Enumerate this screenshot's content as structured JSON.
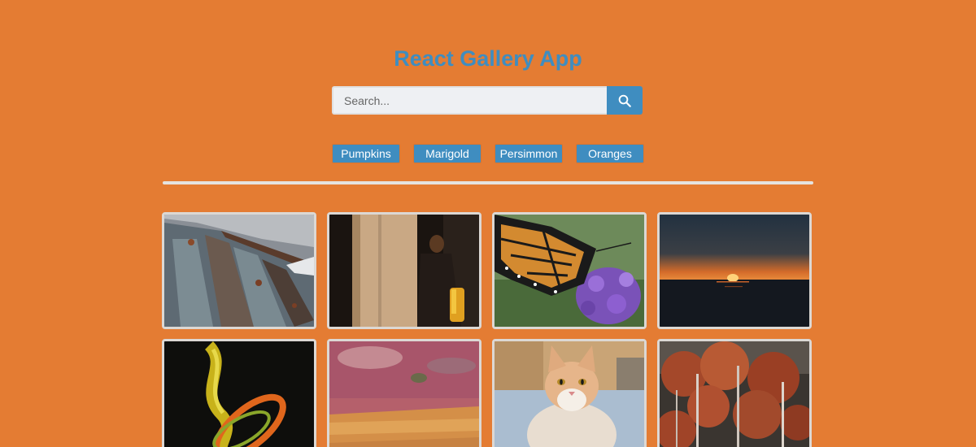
{
  "header": {
    "title": "React Gallery App"
  },
  "search": {
    "placeholder": "Search...",
    "value": "",
    "button_icon": "search-icon"
  },
  "nav": {
    "links": [
      {
        "label": "Pumpkins"
      },
      {
        "label": "Marigold"
      },
      {
        "label": "Persimmon"
      },
      {
        "label": "Oranges"
      }
    ]
  },
  "colors": {
    "background": "#e47c33",
    "accent": "#3f8dc0",
    "divider": "#e5e3e0"
  },
  "gallery": {
    "photos": [
      {
        "subject": "weathered-wood"
      },
      {
        "subject": "person-in-doorway"
      },
      {
        "subject": "monarch-butterfly"
      },
      {
        "subject": "sunset-over-sea"
      },
      {
        "subject": "abstract-swirl"
      },
      {
        "subject": "peeling-paint-wall"
      },
      {
        "subject": "cat"
      },
      {
        "subject": "autumn-trees"
      }
    ]
  }
}
